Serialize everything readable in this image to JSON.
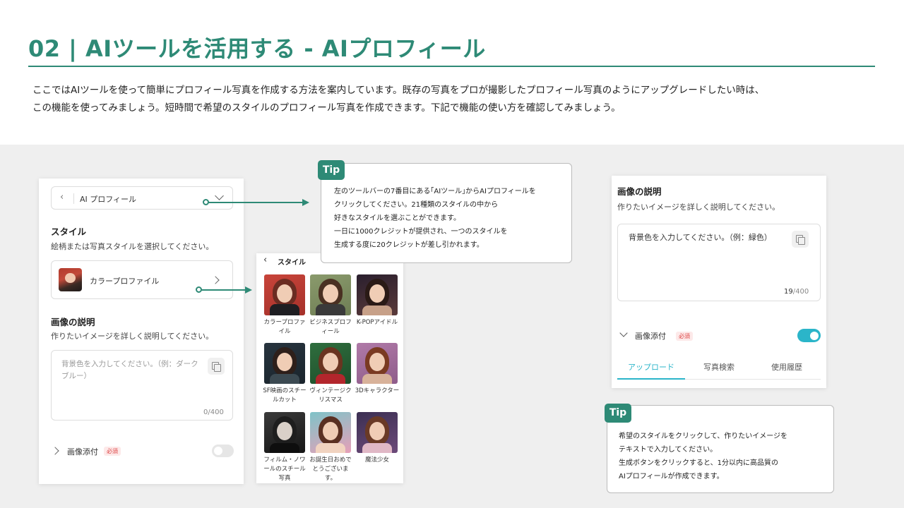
{
  "header": {
    "title": "02 | AIツールを活用する - AIプロフィール",
    "intro_line1": "ここではAIツールを使って簡単にプロフィール写真を作成する方法を案内しています。既存の写真をプロが撮影したプロフィール写真のようにアップグレードしたい時は、",
    "intro_line2": "この機能を使ってみましょう。短時間で希望のスタイルのプロフィール写真を作成できます。下記で機能の使い方を確認してみましょう。"
  },
  "left_panel": {
    "dropdown_label": "AI プロフィール",
    "style_title": "スタイル",
    "style_sub": "絵柄または写真スタイルを選択してください。",
    "selected_style": "カラープロファイル",
    "desc_title": "画像の説明",
    "desc_sub": "作りたいイメージを詳しく説明してください。",
    "textarea_placeholder": "背景色を入力してください。（例：ダークブルー）",
    "counter": "0/400",
    "attach_label": "画像添付",
    "required_badge": "必須"
  },
  "style_grid": {
    "header": "スタイル",
    "items": [
      {
        "label": "カラープロファイル"
      },
      {
        "label": "ビジネスプロフィール"
      },
      {
        "label": "K-POPアイドル"
      },
      {
        "label": "SF映画のスチールカット"
      },
      {
        "label": "ヴィンテージクリスマス"
      },
      {
        "label": "3Dキャラクター"
      },
      {
        "label": "フィルム・ノワールのスチール写真"
      },
      {
        "label": "お誕生日おめでとうございます。"
      },
      {
        "label": "魔法少女"
      }
    ]
  },
  "tip1": {
    "tag": "Tip",
    "line1": "左のツールバーの7番目にある｢AIツール｣からAIプロフィールを",
    "line2": "クリックしてください。21種類のスタイルの中から",
    "line3": "好きなスタイルを選ぶことができます。",
    "line4": "一日に1000クレジットが提供され、一つのスタイルを",
    "line5": "生成する度に20クレジットが差し引かれます。"
  },
  "right_panel": {
    "desc_title": "画像の説明",
    "desc_sub": "作りたいイメージを詳しく説明してください。",
    "textarea_value": "背景色を入力してください。（例：緑色）",
    "counter_current": "19",
    "counter_max": "/400",
    "attach_label": "画像添付",
    "required_badge": "必須",
    "tabs": [
      "アップロード",
      "写真検索",
      "使用履歴"
    ],
    "accent": "#2bb5c9"
  },
  "tip2": {
    "tag": "Tip",
    "line1": "希望のスタイルをクリックして、作りたいイメージを",
    "line2": "テキストで入力してください。",
    "line3": "生成ボタンをクリックすると、1分以内に高品質の",
    "line4": "AIプロフィールが作成できます。"
  },
  "colors": {
    "brand": "#2e8a76",
    "toggle_on": "#2bb5c9"
  }
}
